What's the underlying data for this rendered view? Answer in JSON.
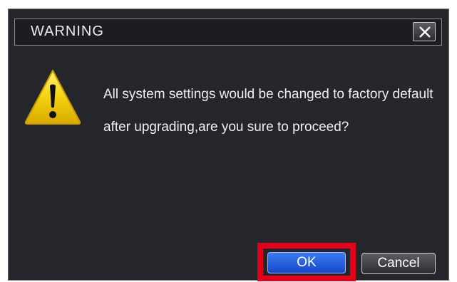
{
  "dialog": {
    "title": "WARNING",
    "close_icon": "close-icon",
    "icon": "warning-triangle-icon",
    "message": "All system settings would be changed to factory default after upgrading,are you sure to proceed?"
  },
  "buttons": {
    "ok_label": "OK",
    "cancel_label": "Cancel"
  },
  "colors": {
    "dialog_background": "#25262b",
    "ok_button": "#2a5fe0",
    "highlight": "#e3001b",
    "warning_icon": "#f2d10c"
  }
}
